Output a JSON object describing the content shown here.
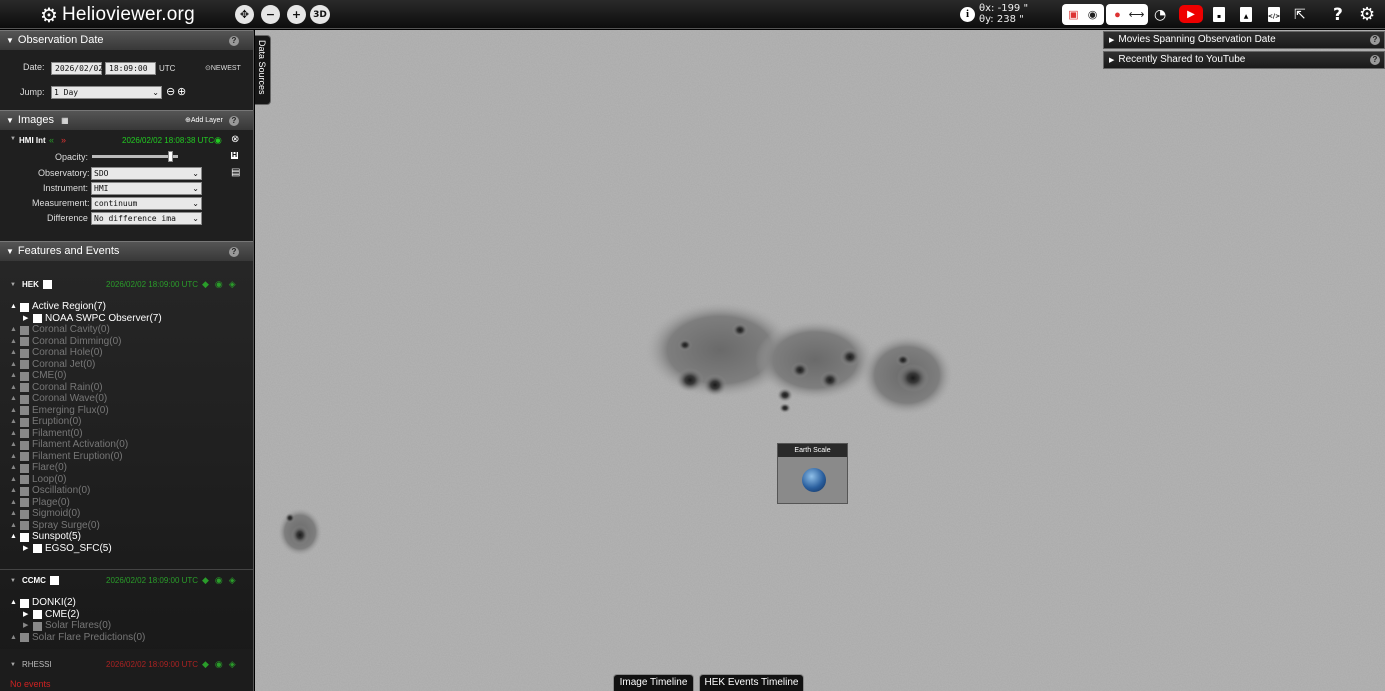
{
  "app": {
    "title": "Helioviewer.org"
  },
  "header": {
    "zoom_buttons": [
      "crosshair-icon",
      "zoom-out-icon",
      "zoom-in-icon"
    ],
    "three_d_label": "3D",
    "coords": {
      "x_label": "θx:",
      "x_value": "-199 \"",
      "y_label": "θy:",
      "y_value": "238 \""
    }
  },
  "observation": {
    "title": "Observation Date",
    "date_label": "Date:",
    "date_value": "2026/02/02",
    "time_value": "18:09:00",
    "utc_label": "UTC",
    "newest_label": "NEWEST",
    "jump_label": "Jump:",
    "jump_value": "1 Day"
  },
  "images": {
    "title": "Images",
    "add_layer_label": "Add Layer",
    "layer": {
      "name": "HMI Int",
      "timestamp": "2026/02/02 18:08:38 UTC",
      "opacity_label": "Opacity:",
      "opacity": 0.92,
      "observatory_label": "Observatory:",
      "observatory_value": "SDO",
      "instrument_label": "Instrument:",
      "instrument_value": "HMI",
      "measurement_label": "Measurement:",
      "measurement_value": "continuum",
      "difference_label": "Difference",
      "difference_value": "No difference ima"
    }
  },
  "features": {
    "title": "Features and Events",
    "hek": {
      "name": "HEK",
      "timestamp": "2026/02/02 18:09:00 UTC",
      "events": [
        {
          "label": "Active Region(7)",
          "enabled": true
        },
        {
          "label": "NOAA SWPC Observer(7)",
          "enabled": true,
          "child": true
        },
        {
          "label": "Coronal Cavity(0)",
          "enabled": false
        },
        {
          "label": "Coronal Dimming(0)",
          "enabled": false
        },
        {
          "label": "Coronal Hole(0)",
          "enabled": false
        },
        {
          "label": "Coronal Jet(0)",
          "enabled": false
        },
        {
          "label": "CME(0)",
          "enabled": false
        },
        {
          "label": "Coronal Rain(0)",
          "enabled": false
        },
        {
          "label": "Coronal Wave(0)",
          "enabled": false
        },
        {
          "label": "Emerging Flux(0)",
          "enabled": false
        },
        {
          "label": "Eruption(0)",
          "enabled": false
        },
        {
          "label": "Filament(0)",
          "enabled": false
        },
        {
          "label": "Filament Activation(0)",
          "enabled": false
        },
        {
          "label": "Filament Eruption(0)",
          "enabled": false
        },
        {
          "label": "Flare(0)",
          "enabled": false
        },
        {
          "label": "Loop(0)",
          "enabled": false
        },
        {
          "label": "Oscillation(0)",
          "enabled": false
        },
        {
          "label": "Plage(0)",
          "enabled": false
        },
        {
          "label": "Sigmoid(0)",
          "enabled": false
        },
        {
          "label": "Spray Surge(0)",
          "enabled": false
        },
        {
          "label": "Sunspot(5)",
          "enabled": true
        },
        {
          "label": "EGSO_SFC(5)",
          "enabled": true,
          "child": true
        }
      ]
    },
    "ccmc": {
      "name": "CCMC",
      "timestamp": "2026/02/02 18:09:00 UTC",
      "events": [
        {
          "label": "DONKI(2)",
          "enabled": true
        },
        {
          "label": "CME(2)",
          "enabled": true,
          "child": true
        },
        {
          "label": "Solar Flares(0)",
          "enabled": false,
          "child": true
        },
        {
          "label": "Solar Flare Predictions(0)",
          "enabled": false
        }
      ]
    },
    "rhessi": {
      "name": "RHESSI",
      "timestamp": "2026/02/02 18:09:00 UTC",
      "no_events": "No events"
    }
  },
  "main": {
    "data_sources_tab": "Data Sources",
    "accordions": [
      "Movies Spanning Observation Date",
      "Recently Shared to YouTube"
    ],
    "earth_scale_title": "Earth Scale",
    "timeline_tabs": [
      "Image Timeline",
      "HEK Events Timeline"
    ]
  },
  "colors": {
    "accent_green": "#22cc22",
    "rhessi_red": "#cc2222",
    "youtube_red": "#ee0000"
  }
}
